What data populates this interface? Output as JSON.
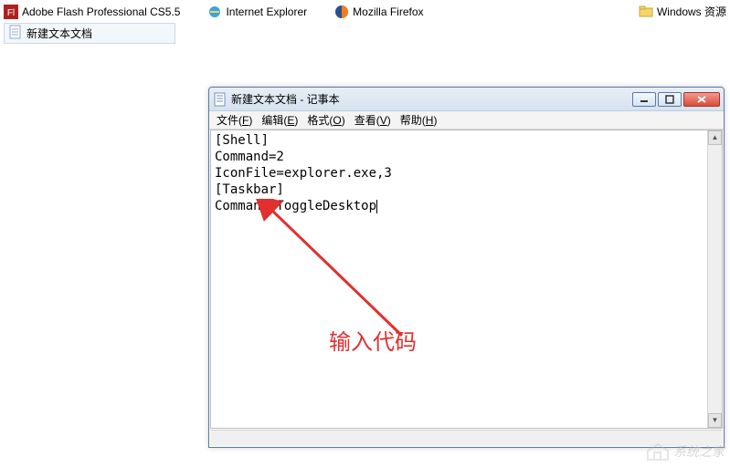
{
  "desktop": {
    "items": [
      {
        "label": "Adobe Flash Professional CS5.5",
        "icon": "flash"
      },
      {
        "label": "Internet Explorer",
        "icon": "ie"
      },
      {
        "label": "Mozilla Firefox",
        "icon": "firefox"
      },
      {
        "label": "Windows 资源",
        "icon": "folder"
      }
    ],
    "file_item": {
      "label": "新建文本文档",
      "icon": "textfile"
    }
  },
  "notepad": {
    "title": "新建文本文档 - 记事本",
    "menus": {
      "file": {
        "label": "文件",
        "accel": "F"
      },
      "edit": {
        "label": "编辑",
        "accel": "E"
      },
      "format": {
        "label": "格式",
        "accel": "O"
      },
      "view": {
        "label": "查看",
        "accel": "V"
      },
      "help": {
        "label": "帮助",
        "accel": "H"
      }
    },
    "content_lines": [
      "[Shell]",
      "Command=2",
      "IconFile=explorer.exe,3",
      "[Taskbar]",
      "Command=ToggleDesktop"
    ],
    "statusbar": ""
  },
  "annotation": {
    "text": "输入代码",
    "color": "#e03030"
  },
  "watermark": {
    "text": "系统之家"
  }
}
